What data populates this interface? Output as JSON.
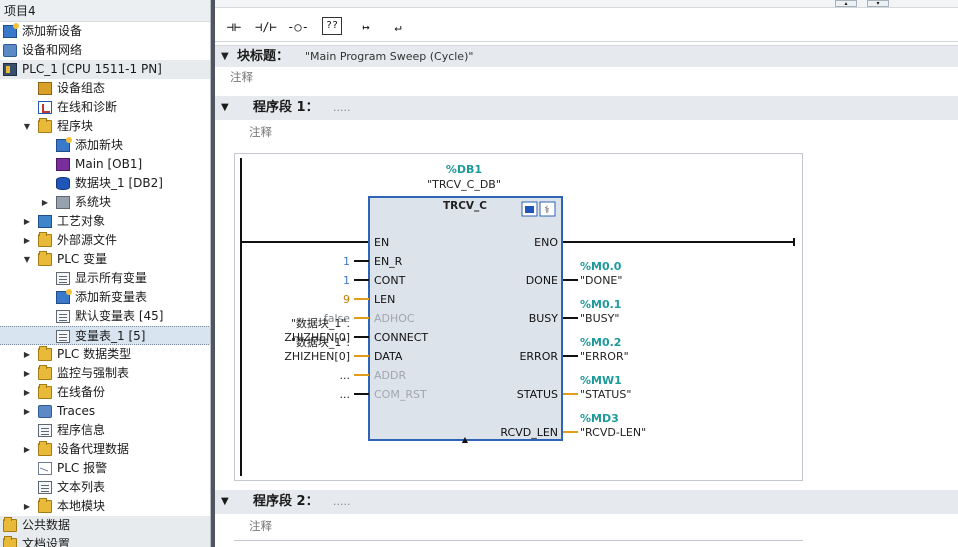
{
  "project": {
    "root_label": "项目4",
    "items": [
      {
        "label": "添加新设备",
        "level": 0,
        "expander": "",
        "icon": "add-device-icon"
      },
      {
        "label": "设备和网络",
        "level": 0,
        "expander": "",
        "icon": "network-icon"
      },
      {
        "label": "PLC_1 [CPU 1511-1 PN]",
        "level": 0,
        "expander": "",
        "icon": "plc-icon"
      },
      {
        "label": "设备组态",
        "level": 1,
        "expander": "",
        "icon": "tools-icon"
      },
      {
        "label": "在线和诊断",
        "level": 1,
        "expander": "",
        "icon": "diagnostics-icon"
      },
      {
        "label": "程序块",
        "level": 1,
        "expander": "▼",
        "icon": "folder-icon"
      },
      {
        "label": "添加新块",
        "level": 2,
        "expander": "",
        "icon": "add-block-icon"
      },
      {
        "label": "Main [OB1]",
        "level": 2,
        "expander": "",
        "icon": "ob-icon"
      },
      {
        "label": "数据块_1 [DB2]",
        "level": 2,
        "expander": "",
        "icon": "db-icon"
      },
      {
        "label": "系统块",
        "level": 2,
        "expander": "▶",
        "icon": "system-block-icon"
      },
      {
        "label": "工艺对象",
        "level": 1,
        "expander": "▶",
        "icon": "technology-object-icon"
      },
      {
        "label": "外部源文件",
        "level": 1,
        "expander": "▶",
        "icon": "folder-icon"
      },
      {
        "label": "PLC 变量",
        "level": 1,
        "expander": "▼",
        "icon": "folder-icon"
      },
      {
        "label": "显示所有变量",
        "level": 2,
        "expander": "",
        "icon": "tag-table-icon"
      },
      {
        "label": "添加新变量表",
        "level": 2,
        "expander": "",
        "icon": "add-tag-table-icon"
      },
      {
        "label": "默认变量表 [45]",
        "level": 2,
        "expander": "",
        "icon": "tag-table-icon"
      },
      {
        "label": "变量表_1 [5]",
        "level": 2,
        "expander": "",
        "icon": "tag-table-icon",
        "selected": true
      },
      {
        "label": "PLC 数据类型",
        "level": 1,
        "expander": "▶",
        "icon": "folder-icon"
      },
      {
        "label": "监控与强制表",
        "level": 1,
        "expander": "▶",
        "icon": "folder-icon"
      },
      {
        "label": "在线备份",
        "level": 1,
        "expander": "▶",
        "icon": "folder-icon"
      },
      {
        "label": "Traces",
        "level": 1,
        "expander": "▶",
        "icon": "traces-icon"
      },
      {
        "label": "程序信息",
        "level": 1,
        "expander": "",
        "icon": "program-info-icon"
      },
      {
        "label": "设备代理数据",
        "level": 1,
        "expander": "▶",
        "icon": "folder-icon"
      },
      {
        "label": "PLC 报警",
        "level": 1,
        "expander": "",
        "icon": "alarm-icon"
      },
      {
        "label": "文本列表",
        "level": 1,
        "expander": "",
        "icon": "text-list-icon"
      },
      {
        "label": "本地模块",
        "level": 1,
        "expander": "▶",
        "icon": "folder-icon"
      },
      {
        "label": "公共数据",
        "level": 0,
        "expander": "",
        "icon": "folder-icon"
      },
      {
        "label": "文档设置",
        "level": 0,
        "expander": "",
        "icon": "folder-icon"
      }
    ]
  },
  "toolbar": {
    "buttons": [
      {
        "glyph": "⊣⊢",
        "name": "no-contact-icon"
      },
      {
        "glyph": "⊣/⊢",
        "name": "nc-contact-icon"
      },
      {
        "glyph": "-○-",
        "name": "coil-icon"
      },
      {
        "glyph": "??",
        "name": "empty-box-icon"
      },
      {
        "glyph": "↦",
        "name": "open-branch-icon"
      },
      {
        "glyph": "↵",
        "name": "close-branch-icon"
      }
    ]
  },
  "block": {
    "title_label": "块标题：",
    "title_value": "\"Main Program Sweep (Cycle)\"",
    "comment": "注释"
  },
  "networks": [
    {
      "label": "程序段 1：",
      "title": ".....",
      "comment": "注释"
    },
    {
      "label": "程序段 2：",
      "title": ".....",
      "comment": "注释"
    }
  ],
  "fbd": {
    "instance_address": "%DB1",
    "instance_name": "\"TRCV_C_DB\"",
    "block_name": "TRCV_C",
    "inputs": [
      {
        "pin": "EN",
        "value": "",
        "dim": false
      },
      {
        "pin": "EN_R",
        "value": "1",
        "dim": false
      },
      {
        "pin": "CONT",
        "value": "1",
        "dim": false
      },
      {
        "pin": "LEN",
        "value": "9",
        "dim": false
      },
      {
        "pin": "ADHOC",
        "value": "false",
        "dim": true
      },
      {
        "pin": "CONNECT",
        "value_line1": "\"数据块_1\".",
        "value_line2": "ZHIZHEN[0]",
        "dim": false
      },
      {
        "pin": "DATA",
        "value_line1": "\"数据块_1\".",
        "value_line2": "ZHIZHEN[0]",
        "dim": false
      },
      {
        "pin": "ADDR",
        "value": "...",
        "dim": true
      },
      {
        "pin": "COM_RST",
        "value": "...",
        "dim": true
      }
    ],
    "outputs": [
      {
        "pin": "ENO",
        "address": "",
        "tag": ""
      },
      {
        "pin": "DONE",
        "address": "%M0.0",
        "tag": "\"DONE\""
      },
      {
        "pin": "BUSY",
        "address": "%M0.1",
        "tag": "\"BUSY\""
      },
      {
        "pin": "ERROR",
        "address": "%M0.2",
        "tag": "\"ERROR\""
      },
      {
        "pin": "STATUS",
        "address": "%MW1",
        "tag": "\"STATUS\""
      },
      {
        "pin": "RCVD_LEN",
        "address": "%MD3",
        "tag": "\"RCVD-LEN\""
      }
    ]
  },
  "colors": {
    "address": "#1d9a9a",
    "constant": "#3e7ac2",
    "wire_orange": "#e39b1a",
    "block_fill": "#dde3ea",
    "block_border": "#2f63b6"
  }
}
